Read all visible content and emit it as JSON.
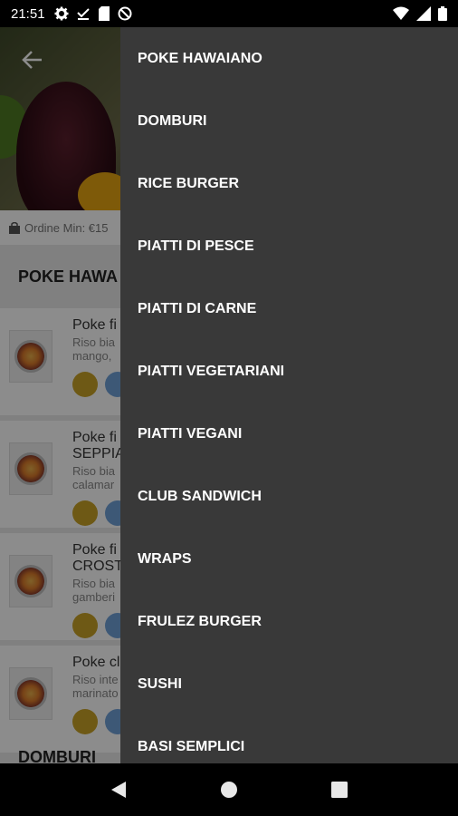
{
  "status_bar": {
    "time": "21:51",
    "left_icons": [
      "gear-icon",
      "download-done-icon",
      "sd-card-icon",
      "blocked-icon"
    ],
    "right_icons": [
      "wifi-icon",
      "signal-icon",
      "battery-icon"
    ]
  },
  "background": {
    "min_order": "Ordine Min: €15",
    "section_title": "POKE HAWA",
    "items": [
      {
        "name": "Poke fi",
        "desc": "Riso bia",
        "desc2": "mango,"
      },
      {
        "name": "Poke fi",
        "name2": "SEPPIA",
        "desc": "Riso bia",
        "desc2": "calamar"
      },
      {
        "name": "Poke fi",
        "name2": "CROST",
        "desc": "Riso bia",
        "desc2": "gamberi"
      },
      {
        "name": "Poke cl",
        "desc": "Riso inte",
        "desc2": "marinato"
      }
    ],
    "next_section": "DOMBURI"
  },
  "drawer": {
    "items": [
      "POKE HAWAIANO",
      "DOMBURI",
      "RICE BURGER",
      "PIATTI DI PESCE",
      "PIATTI DI CARNE",
      "PIATTI VEGETARIANI",
      "PIATTI VEGANI",
      "CLUB SANDWICH",
      "WRAPS",
      "FRULEZ BURGER",
      "SUSHI",
      "BASI SEMPLICI"
    ]
  },
  "colors": {
    "drawer_bg": "#393939",
    "drawer_text": "#ffffff",
    "status_bar": "#000000",
    "nav_bar": "#000000"
  }
}
